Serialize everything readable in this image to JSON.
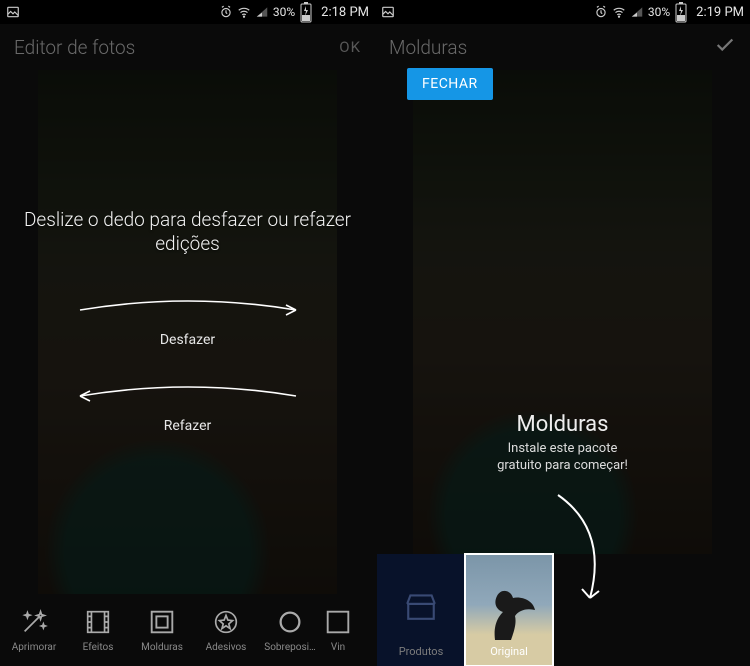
{
  "left": {
    "status": {
      "battery": "30%",
      "time": "2:18 PM"
    },
    "title": "Editor de fotos",
    "ok": "OK",
    "tip_headline": "Deslize o dedo para desfazer ou refazer edições",
    "undo_label": "Desfazer",
    "redo_label": "Refazer",
    "tools": [
      {
        "id": "aprimorar",
        "label": "Aprimorar"
      },
      {
        "id": "efeitos",
        "label": "Efeitos"
      },
      {
        "id": "molduras",
        "label": "Molduras"
      },
      {
        "id": "adesivos",
        "label": "Adesivos"
      },
      {
        "id": "sobreposi",
        "label": "Sobreposi…"
      },
      {
        "id": "vin",
        "label": "Vin"
      }
    ]
  },
  "right": {
    "status": {
      "battery": "30%",
      "time": "2:19 PM"
    },
    "title": "Molduras",
    "close_label": "FECHAR",
    "tip_title": "Molduras",
    "tip_body_line1": "Instale este pacote",
    "tip_body_line2": "gratuito para começar!",
    "thumbs": {
      "produtos": "Produtos",
      "original": "Original"
    }
  }
}
